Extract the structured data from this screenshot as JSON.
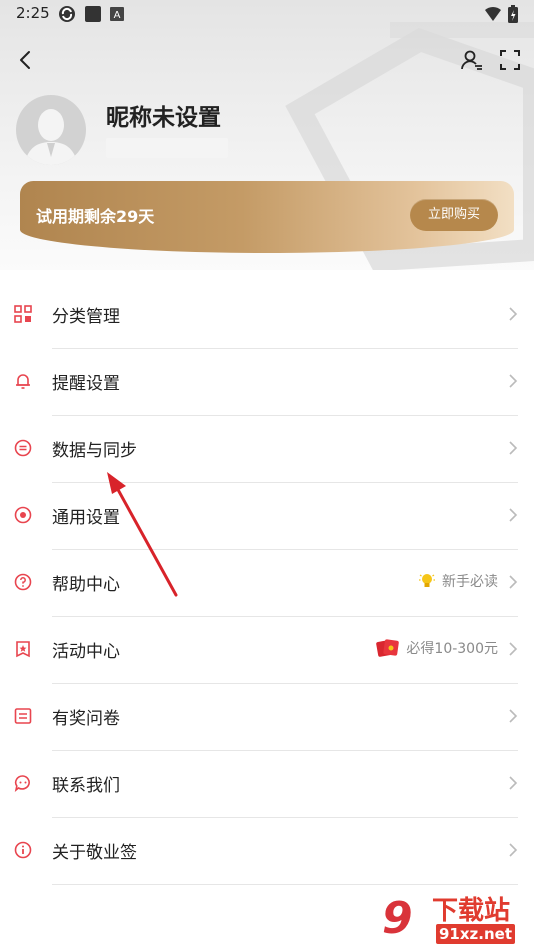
{
  "status_bar": {
    "time": "2:25",
    "left_icons": [
      "sync-icon",
      "square-icon",
      "a-icon"
    ],
    "right_icons": [
      "wifi-icon",
      "battery-icon"
    ]
  },
  "topbar": {
    "back_icon": "chevron-left-icon",
    "switch_icon": "user-switch-icon",
    "scan_icon": "scan-frame-icon"
  },
  "profile": {
    "nickname": "昵称未设置"
  },
  "trial": {
    "text": "试用期剩余29天",
    "buy_label": "立即购买",
    "colors": {
      "gold_start": "#b0854f",
      "gold_end": "#f2dfc4",
      "button": "#b6884c"
    }
  },
  "menu": {
    "items": [
      {
        "label": "分类管理",
        "icon": "category-grid-icon"
      },
      {
        "label": "提醒设置",
        "icon": "bell-icon"
      },
      {
        "label": "数据与同步",
        "icon": "sync-circle-icon"
      },
      {
        "label": "通用设置",
        "icon": "settings-dot-icon"
      },
      {
        "label": "帮助中心",
        "icon": "help-circle-icon",
        "extra_text": "新手必读",
        "extra_icon": "lightbulb-icon"
      },
      {
        "label": "活动中心",
        "icon": "star-flag-icon",
        "extra_text": "必得10-300元",
        "extra_icon": "red-envelope-icon"
      },
      {
        "label": "有奖问卷",
        "icon": "survey-icon"
      },
      {
        "label": "联系我们",
        "icon": "chat-bubble-icon"
      },
      {
        "label": "关于敬业签",
        "icon": "info-circle-icon"
      }
    ],
    "accent_color": "#e8454f"
  },
  "watermark": {
    "badge": "9",
    "title": "下载站",
    "url": "91xz.net"
  }
}
